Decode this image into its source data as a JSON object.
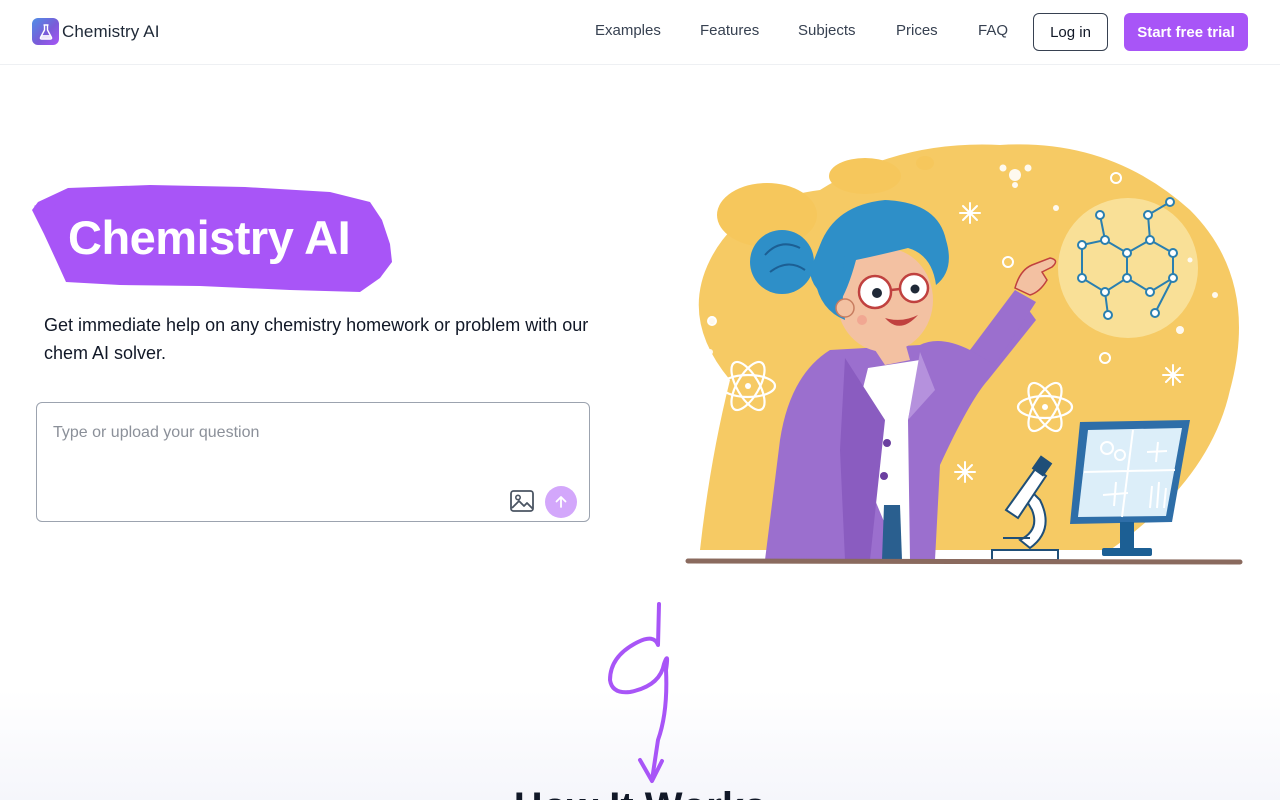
{
  "brand": {
    "name": "Chemistry AI",
    "icon": "flask-icon"
  },
  "nav": {
    "items": [
      {
        "label": "Examples"
      },
      {
        "label": "Features"
      },
      {
        "label": "Subjects"
      },
      {
        "label": "Prices"
      },
      {
        "label": "FAQ"
      }
    ],
    "login_label": "Log in",
    "trial_label": "Start free trial"
  },
  "hero": {
    "title": "Chemistry AI",
    "subtitle": "Get immediate help on any chemistry homework or problem with our chem AI solver.",
    "input_placeholder": "Type or upload your question",
    "upload_icon": "image-upload-icon",
    "send_icon": "arrow-up-icon"
  },
  "next_section": {
    "title": "How It Works"
  },
  "colors": {
    "accent": "#a855f7",
    "accent_light": "#d3a7fb",
    "text": "#111827",
    "illustration_yellow": "#f6c75c",
    "coat_purple": "#9b6fce",
    "hair_blue": "#2e8fc8"
  }
}
